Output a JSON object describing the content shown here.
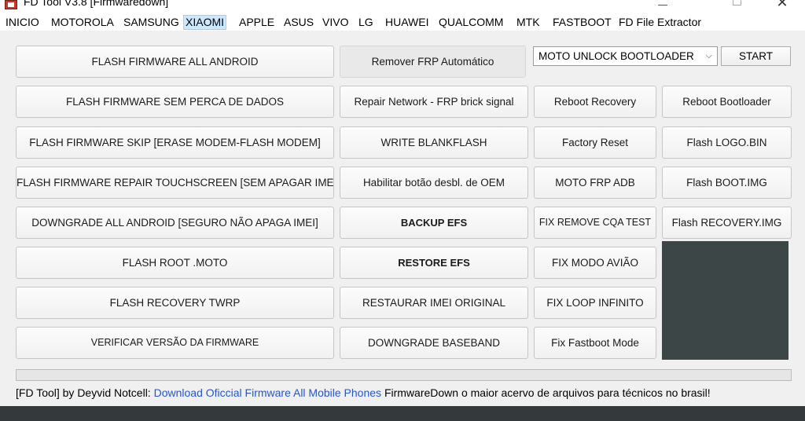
{
  "window": {
    "title": "FD Tool V3.8 [Firmwaredown]",
    "close_glyph": "✕"
  },
  "menu": [
    {
      "label": "INICIO",
      "active": false
    },
    {
      "label": "MOTOROLA",
      "active": false
    },
    {
      "label": "SAMSUNG",
      "active": false
    },
    {
      "label": "XIAOMI",
      "active": true
    },
    {
      "label": "APPLE",
      "active": false
    },
    {
      "label": "ASUS",
      "active": false
    },
    {
      "label": "VIVO",
      "active": false
    },
    {
      "label": "LG",
      "active": false
    },
    {
      "label": "HUAWEI",
      "active": false
    },
    {
      "label": "QUALCOMM",
      "active": false
    },
    {
      "label": "MTK",
      "active": false
    },
    {
      "label": "FASTBOOT",
      "active": false
    },
    {
      "label": "FD File Extractor",
      "active": false
    }
  ],
  "columns": {
    "col1": [
      "FLASH FIRMWARE ALL ANDROID",
      "FLASH FIRMWARE SEM PERCA DE DADOS",
      "FLASH FIRMWARE SKIP [ERASE MODEM-FLASH MODEM]",
      "FLASH FIRMWARE REPAIR TOUCHSCREEN [SEM APAGAR IMEI]",
      "DOWNGRADE ALL ANDROID [SEGURO NÃO APAGA IMEI]",
      "FLASH ROOT .MOTO",
      "FLASH RECOVERY TWRP",
      "VERIFICAR VERSÃO DA FIRMWARE"
    ],
    "col2": [
      "Remover FRP Automático",
      "Repair Network - FRP brick signal",
      "WRITE BLANKFLASH",
      "Habilitar botão desbl. de OEM",
      "BACKUP EFS",
      "RESTORE EFS",
      "RESTAURAR IMEI ORIGINAL",
      "DOWNGRADE BASEBAND"
    ],
    "col3": [
      "Reboot Recovery",
      "Factory Reset",
      "MOTO FRP ADB",
      "FIX REMOVE CQA TEST",
      "FIX MODO AVIÃO",
      "FIX LOOP INFINITO",
      "Fix Fastboot Mode"
    ],
    "col4": [
      "Reboot Bootloader",
      "Flash LOGO.BIN",
      "Flash BOOT.IMG",
      "Flash RECOVERY.IMG"
    ]
  },
  "mode_select": {
    "value": "MOTO UNLOCK BOOTLOADER",
    "chevron": "⌵"
  },
  "start_label": "START",
  "progress": 0,
  "footer": {
    "credit": "[FD Tool] by Deyvid Notcell: ",
    "link": "Download Oficcial Firmware All Mobile Phones",
    "tagline": " FirmwareDown o maior acervo de arquivos para técnicos no brasil!"
  }
}
